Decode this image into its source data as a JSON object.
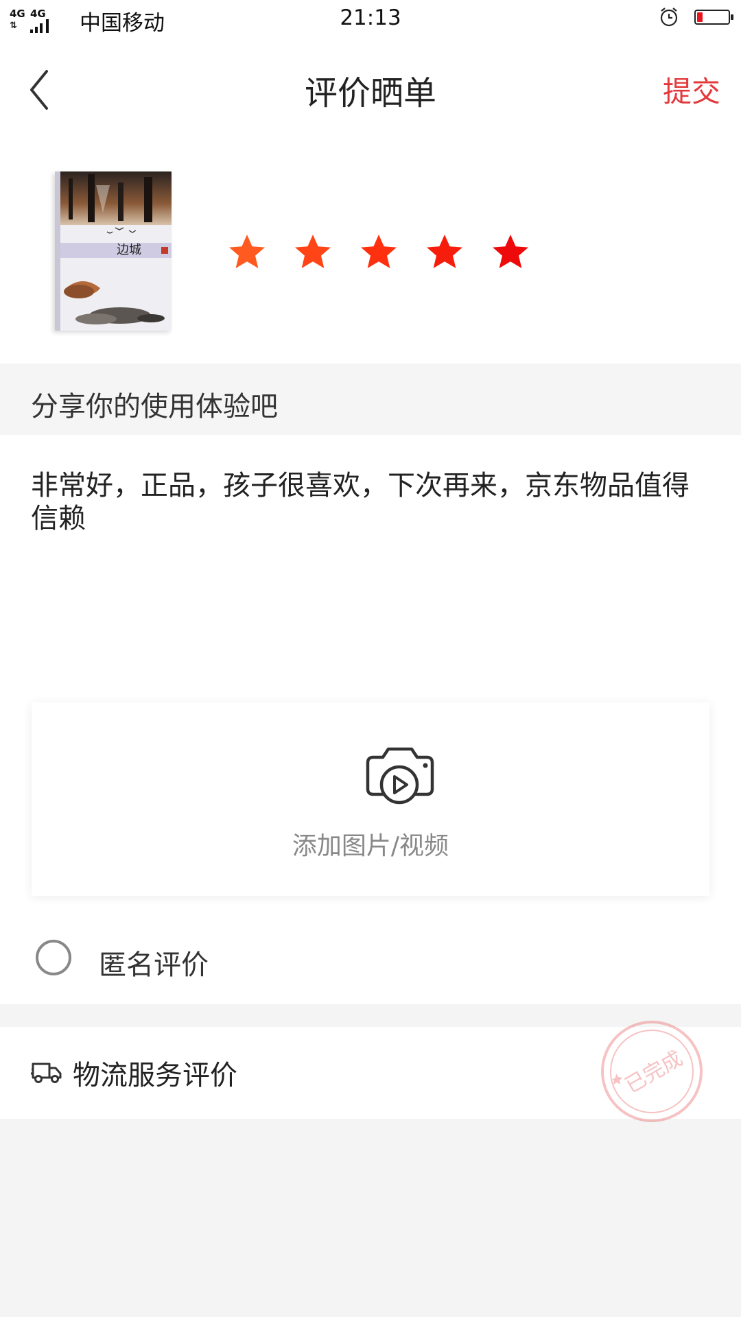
{
  "status_bar": {
    "network": "4G",
    "network2": "4G",
    "carrier": "中国移动",
    "time": "21:13",
    "battery_level": 0.18,
    "colors": {
      "battery_low": "#e8141e"
    }
  },
  "header": {
    "title": "评价晒单",
    "submit_label": "提交",
    "back_icon": "chevron-left-icon"
  },
  "product": {
    "book_title": "边城",
    "rating": 5,
    "max_rating": 5,
    "star_colors": [
      "#ff5a1f",
      "#ff4417",
      "#ff3010",
      "#f71d0c",
      "#ee0a0a"
    ]
  },
  "review": {
    "prompt": "分享你的使用体验吧",
    "text": "非常好，正品，孩子很喜欢，下次再来，京东物品值得信赖",
    "upload_label": "添加图片/视频",
    "upload_icon": "camera-video-icon",
    "anonymous_label": "匿名评价",
    "anonymous_checked": false
  },
  "logistics": {
    "label": "物流服务评价",
    "icon": "truck-icon",
    "stamp_text": "已完成"
  },
  "colors": {
    "accent": "#e4393c",
    "background": "#f4f4f4"
  }
}
